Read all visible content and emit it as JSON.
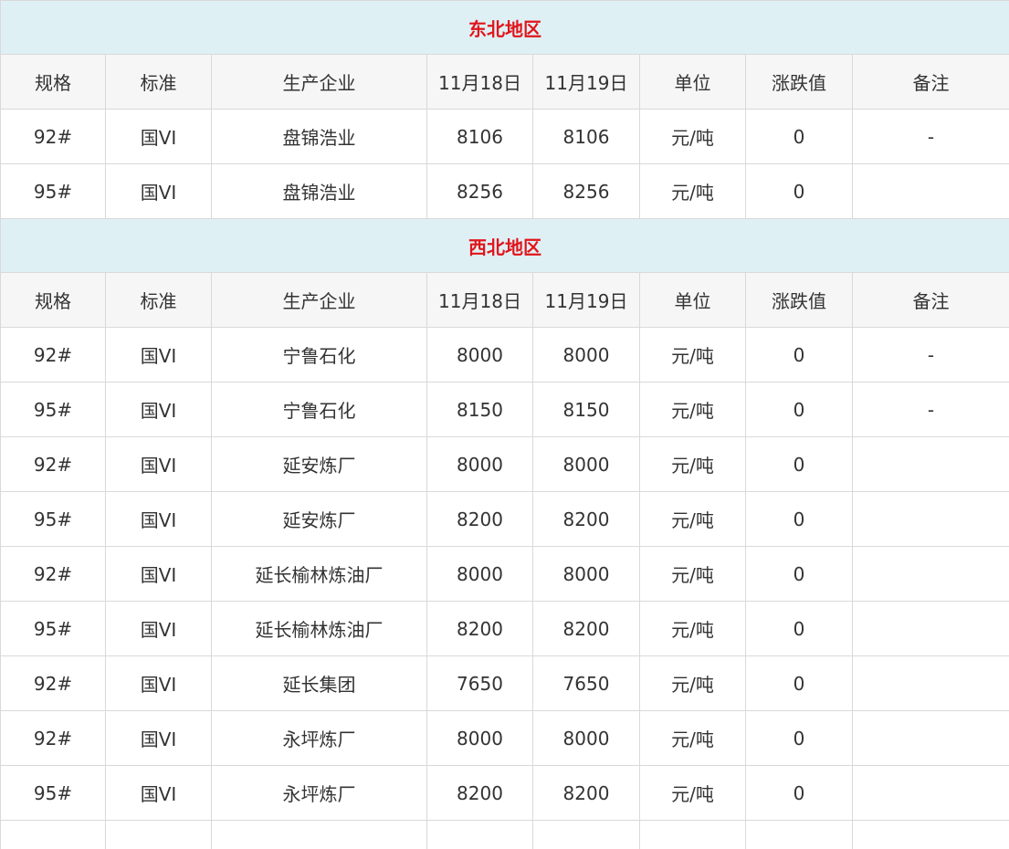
{
  "columns": [
    "规格",
    "标准",
    "生产企业",
    "11月18日",
    "11月19日",
    "单位",
    "涨跌值",
    "备注"
  ],
  "regions": [
    {
      "name": "东北地区",
      "rows": [
        [
          "92#",
          "国VI",
          "盘锦浩业",
          "8106",
          "8106",
          "元/吨",
          "0",
          "-"
        ],
        [
          "95#",
          "国VI",
          "盘锦浩业",
          "8256",
          "8256",
          "元/吨",
          "0",
          ""
        ]
      ]
    },
    {
      "name": "西北地区",
      "rows": [
        [
          "92#",
          "国VI",
          "宁鲁石化",
          "8000",
          "8000",
          "元/吨",
          "0",
          "-"
        ],
        [
          "95#",
          "国VI",
          "宁鲁石化",
          "8150",
          "8150",
          "元/吨",
          "0",
          "-"
        ],
        [
          "92#",
          "国VI",
          "延安炼厂",
          "8000",
          "8000",
          "元/吨",
          "0",
          ""
        ],
        [
          "95#",
          "国VI",
          "延安炼厂",
          "8200",
          "8200",
          "元/吨",
          "0",
          ""
        ],
        [
          "92#",
          "国VI",
          "延长榆林炼油厂",
          "8000",
          "8000",
          "元/吨",
          "0",
          ""
        ],
        [
          "95#",
          "国VI",
          "延长榆林炼油厂",
          "8200",
          "8200",
          "元/吨",
          "0",
          ""
        ],
        [
          "92#",
          "国VI",
          "延长集团",
          "7650",
          "7650",
          "元/吨",
          "0",
          ""
        ],
        [
          "92#",
          "国VI",
          "永坪炼厂",
          "8000",
          "8000",
          "元/吨",
          "0",
          ""
        ],
        [
          "95#",
          "国VI",
          "永坪炼厂",
          "8200",
          "8200",
          "元/吨",
          "0",
          ""
        ],
        [
          "",
          "",
          "",
          "",
          "",
          "",
          "",
          ""
        ]
      ]
    }
  ],
  "colors": {
    "region_background": "#dff0f5",
    "region_text": "#e0151b",
    "header_background": "#f6f6f6",
    "border": "#d9d9d9",
    "text": "#333333"
  }
}
